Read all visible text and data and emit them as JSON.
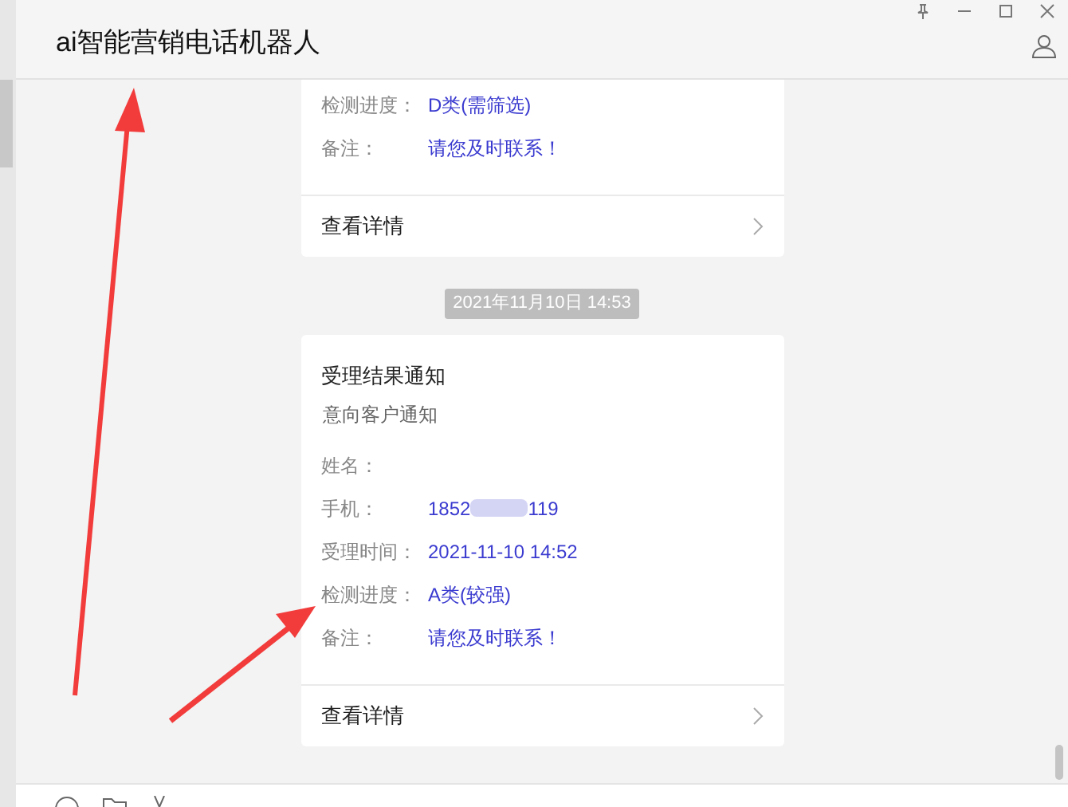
{
  "window": {
    "title": "ai智能营销电话机器人"
  },
  "messages": [
    {
      "kind": "card",
      "fields": [
        {
          "label": "检测进度：",
          "value": "D类(需筛选)"
        },
        {
          "label": "备注：",
          "value": "请您及时联系！"
        }
      ],
      "link": "查看详情"
    },
    {
      "kind": "timestamp",
      "text": "2021年11月10日  14:53"
    },
    {
      "kind": "card",
      "title": "受理结果通知",
      "subtitle": "意向客户通知",
      "fields": [
        {
          "label": "姓名："
        },
        {
          "label": "手机：",
          "value": "1852",
          "value_end": "119",
          "masked": true
        },
        {
          "label": "受理时间：",
          "value": "2021-11-10 14:52"
        },
        {
          "label": "检测进度：",
          "value": "A类(较强)"
        },
        {
          "label": "备注：",
          "value": "请您及时联系！"
        }
      ],
      "link": "查看详情"
    }
  ]
}
